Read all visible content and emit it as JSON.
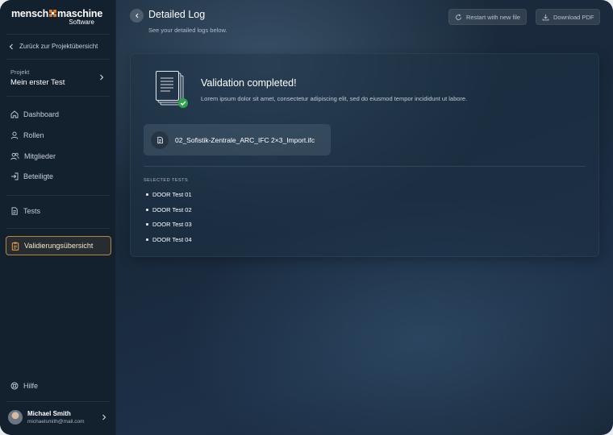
{
  "brand": {
    "name_left": "mensch",
    "name_right": "maschine",
    "subtitle": "Software",
    "mark_color": "#e07b2a"
  },
  "sidebar": {
    "back_label": "Zurück zur Projektübersicht",
    "project": {
      "label": "Projekt",
      "name": "Mein erster Test"
    },
    "nav_group_1": [
      {
        "label": "Dashboard",
        "icon": "home-icon"
      },
      {
        "label": "Rollen",
        "icon": "user-icon"
      },
      {
        "label": "Mitglieder",
        "icon": "users-icon"
      },
      {
        "label": "Beteiligte",
        "icon": "login-icon"
      }
    ],
    "nav_group_2": [
      {
        "label": "Tests",
        "icon": "document-icon"
      }
    ],
    "active_item": {
      "label": "Validierungsübersicht",
      "icon": "clipboard-icon"
    },
    "help_label": "Hilfe",
    "user": {
      "name": "Michael Smith",
      "email": "michaelsmith@mail.com"
    }
  },
  "header": {
    "title": "Detailed Log",
    "subtitle": "See your detailed logs below.",
    "restart_label": "Restart with new file",
    "download_label": "Download PDF"
  },
  "result": {
    "title": "Validation completed!",
    "description": "Lorem ipsum dolor sit amet, consectetur adipiscing elit, sed do eiusmod tempor incididunt ut labore.",
    "file_name": "02_Sofistik-Zentrale_ARC_IFC 2×3_Import.ifc",
    "tests_heading": "SELECTED TESTS",
    "tests": [
      "DOOR Test 01",
      "DOOR Test 02",
      "DOOR Test 03",
      "DOOR Test 04"
    ]
  },
  "colors": {
    "accent": "#b8873f",
    "success": "#2fa34a"
  }
}
